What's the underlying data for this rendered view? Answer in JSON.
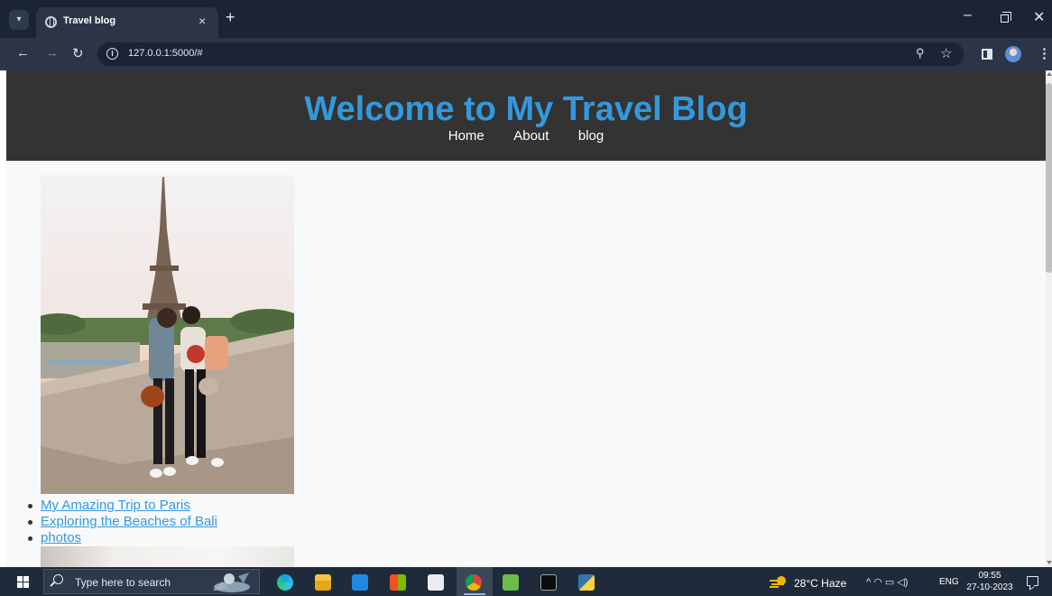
{
  "browser": {
    "tab": {
      "title": "Travel blog",
      "close_glyph": "×"
    },
    "new_tab_glyph": "+",
    "url": "127.0.0.1:5000/#",
    "window_controls": {
      "minimize": "–",
      "close": "✕"
    },
    "icons": [
      "tab-search-icon",
      "back-icon",
      "forward-icon",
      "reload-icon",
      "site-info-icon",
      "zoom-icon",
      "bookmark-star-icon",
      "side-panel-icon",
      "profile-avatar",
      "menu-kebab-icon"
    ]
  },
  "site": {
    "title": "Welcome to My Travel Blog",
    "nav": [
      {
        "label": "Home"
      },
      {
        "label": "About"
      },
      {
        "label": "blog"
      }
    ],
    "posts": [
      {
        "label": "My Amazing Trip to Paris"
      },
      {
        "label": "Exploring the Beaches of Bali"
      },
      {
        "label": "photos"
      }
    ],
    "colors": {
      "header_bg": "#333333",
      "accent": "#3498db",
      "page_bg": "#f8f9fb"
    }
  },
  "taskbar": {
    "search_placeholder": "Type here to search",
    "weather": "28°C  Haze",
    "tray_glyphs": "^  ◠  ▭  ◁)",
    "language": "ENG",
    "time": "09:55",
    "date": "27-10-2023",
    "apps": [
      "edge-icon",
      "file-explorer-icon",
      "mail-icon",
      "store-icon",
      "document-icon",
      "chrome-icon",
      "notepad-icon",
      "terminal-icon",
      "python-icon"
    ]
  }
}
